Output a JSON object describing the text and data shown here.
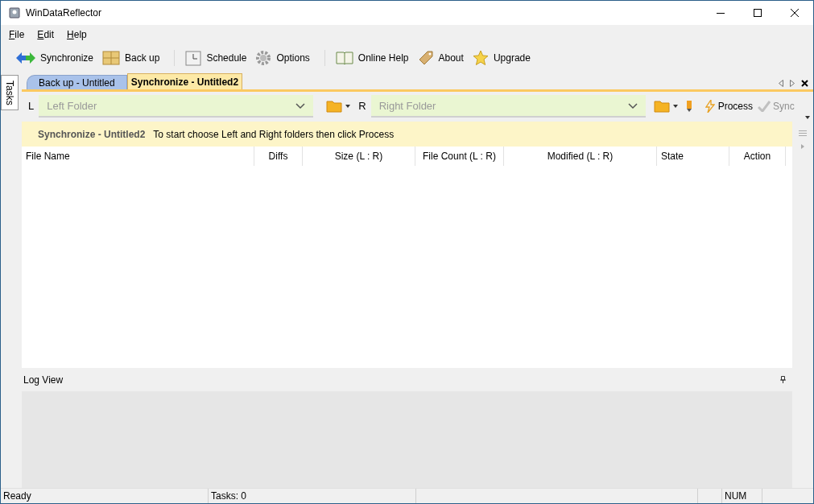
{
  "window": {
    "title": "WinDataReflector"
  },
  "menu": [
    "File",
    "Edit",
    "Help"
  ],
  "toolbar": [
    {
      "kind": "sync",
      "label": "Synchronize"
    },
    {
      "kind": "backup",
      "label": "Back up"
    },
    {
      "kind": "sep"
    },
    {
      "kind": "schedule",
      "label": "Schedule"
    },
    {
      "kind": "options",
      "label": "Options"
    },
    {
      "kind": "sep"
    },
    {
      "kind": "help",
      "label": "Online Help"
    },
    {
      "kind": "about",
      "label": "About"
    },
    {
      "kind": "upgrade",
      "label": "Upgrade"
    }
  ],
  "side_tab": "Tasks",
  "tabs": [
    {
      "label": "Back up - Untitled",
      "selected": false
    },
    {
      "label": "Synchronize - Untitled2",
      "selected": true
    }
  ],
  "folders": {
    "left_label": "L",
    "left_placeholder": "Left Folder",
    "right_label": "R",
    "right_placeholder": "Right Folder",
    "process": "Process",
    "sync": "Sync",
    "sync_disabled": true
  },
  "info": {
    "title": "Synchronize - Untitled2",
    "message": "To start choose Left and Right folders then click Process"
  },
  "table": {
    "columns": [
      "File Name",
      "Diffs",
      "Size (L : R)",
      "File Count (L : R)",
      "Modified (L : R)",
      "State",
      "Action"
    ]
  },
  "log_view": {
    "title": "Log View"
  },
  "status_bar": [
    "Ready",
    "Tasks: 0",
    "NUM"
  ]
}
